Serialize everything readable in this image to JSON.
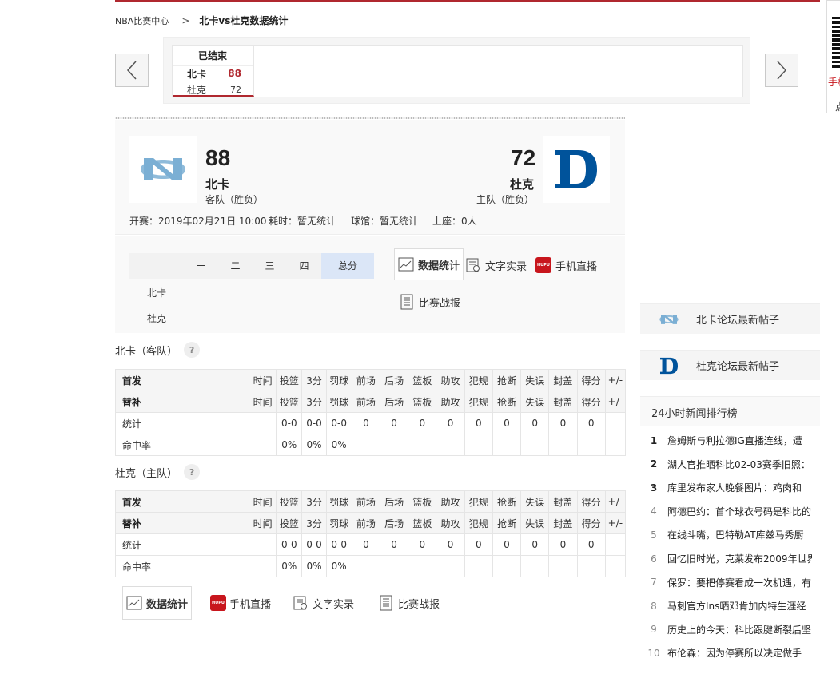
{
  "breadcrumb": {
    "home": "NBA比赛中心",
    "separator": ">",
    "current": "北卡vs杜克数据统计"
  },
  "carousel": {
    "game": {
      "status": "已结束",
      "team1": "北卡",
      "score1": "88",
      "team2": "杜克",
      "score2": "72"
    }
  },
  "qr": {
    "label": "手机",
    "label2": "点"
  },
  "scoreboard": {
    "away": {
      "score": "88",
      "name": "北卡",
      "role": "客队（胜负）"
    },
    "home": {
      "score": "72",
      "name": "杜克",
      "role": "主队（胜负）"
    },
    "meta": {
      "start": "开赛：2019年02月21日 10:00",
      "duration": "耗时：暂无统计",
      "arena": "球馆：暂无统计",
      "attendance": "上座：0人"
    }
  },
  "quarters": {
    "headers": [
      "一",
      "二",
      "三",
      "四",
      "总分"
    ],
    "teams": [
      "北卡",
      "杜克"
    ]
  },
  "tabs": {
    "stats": "数据统计",
    "text_live": "文字实录",
    "mobile_live": "手机直播",
    "report": "比赛战报"
  },
  "away_section": {
    "title": "北卡（客队）",
    "help": "?"
  },
  "home_section": {
    "title": "杜克（主队）",
    "help": "?"
  },
  "stat_table": {
    "starter_label": "首发",
    "bench_label": "替补",
    "columns": [
      "时间",
      "投篮",
      "3分",
      "罚球",
      "前场",
      "后场",
      "篮板",
      "助攻",
      "犯规",
      "抢断",
      "失误",
      "封盖",
      "得分",
      "+/-"
    ],
    "totals_label": "统计",
    "totals": [
      "",
      "0-0",
      "0-0",
      "0-0",
      "0",
      "0",
      "0",
      "0",
      "0",
      "0",
      "0",
      "0",
      "0",
      ""
    ],
    "pct_label": "命中率",
    "pct": [
      "",
      "0%",
      "0%",
      "0%",
      "",
      "",
      "",
      "",
      "",
      "",
      "",
      "",
      "",
      ""
    ]
  },
  "bottom_tabs": {
    "stats": "数据统计",
    "mobile_live": "手机直播",
    "text_live": "文字实录",
    "report": "比赛战报"
  },
  "sidebar": {
    "forum1": "北卡论坛最新帖子",
    "forum2": "杜克论坛最新帖子",
    "news_title": "24小时新闻排行榜",
    "news": [
      {
        "rank": "1",
        "title": "詹姆斯与利拉德IG直播连线，遭"
      },
      {
        "rank": "2",
        "title": "湖人官推晒科比02-03赛季旧照："
      },
      {
        "rank": "3",
        "title": "库里发布家人晚餐图片：鸡肉和"
      },
      {
        "rank": "4",
        "title": "阿德巴约：首个球衣号码是科比的"
      },
      {
        "rank": "5",
        "title": "在线斗嘴，巴特勒AT库兹马秀厨"
      },
      {
        "rank": "6",
        "title": "回忆旧时光，克莱发布2009年世界"
      },
      {
        "rank": "7",
        "title": "保罗：要把停赛看成一次机遇，有"
      },
      {
        "rank": "8",
        "title": "马刺官方Ins晒邓肯加内特生涯经"
      },
      {
        "rank": "9",
        "title": "历史上的今天：科比跟腱断裂后坚"
      },
      {
        "rank": "10",
        "title": "布伦森：因为停赛所以决定做手"
      }
    ]
  },
  "colors": {
    "accent": "#b0282f",
    "unc_blue": "#7BAFD4",
    "duke_blue": "#00539B",
    "highlight": "#dbe6f7"
  }
}
